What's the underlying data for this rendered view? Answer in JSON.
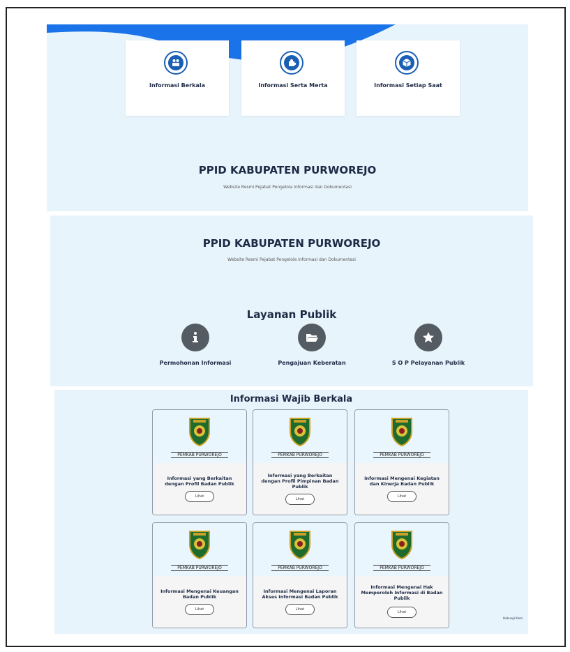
{
  "hero": {
    "categories": [
      {
        "label": "Informasi Berkala",
        "icon": "users-icon"
      },
      {
        "label": "Informasi Serta Merta",
        "icon": "puzzle-icon"
      },
      {
        "label": "Informasi Setiap Saat",
        "icon": "box-icon"
      }
    ],
    "title": "PPID KABUPATEN PURWOREJO",
    "subtitle": "Website Resmi Pejabat Pengelola Informasi dan Dokumentasi"
  },
  "layanan": {
    "header_title": "PPID KABUPATEN PURWOREJO",
    "header_subtitle": "Website Resmi Pejabat Pengelola Informasi dan Dokumentasi",
    "title": "Layanan Publik",
    "services": [
      {
        "label": "Permohonan Informasi",
        "icon": "info-icon"
      },
      {
        "label": "Pengajuan Keberatan",
        "icon": "folder-icon"
      },
      {
        "label": "S O P Pelayanan Publik",
        "icon": "star-icon"
      }
    ]
  },
  "wajib": {
    "title": "Informasi Wajib Berkala",
    "cards": [
      {
        "emblem_caption": "PEMKAB PURWOREJO",
        "text": "Informasi yang Berkaitan dengan Profil Badan Publik",
        "button": "Lihat"
      },
      {
        "emblem_caption": "PEMKAB PURWOREJO",
        "text": "Informasi yang Berkaitan dengan Profil Pimpinan Badan Publik",
        "button": "Lihat"
      },
      {
        "emblem_caption": "PEMKAB PURWOREJO",
        "text": "Informasi Mengenai Kegiatan dan Kinerja Badan Publik",
        "button": "Lihat"
      },
      {
        "emblem_caption": "PEMKAB PURWOREJO",
        "text": "Informasi Mengenai Keuangan Badan Publik",
        "button": "Lihat"
      },
      {
        "emblem_caption": "PEMKAB PURWOREJO",
        "text": "Informasi Mengenai Laporan Akses Informasi Badan Publik",
        "button": "Lihat"
      },
      {
        "emblem_caption": "PEMKAB PURWOREJO",
        "text": "Informasi Mengenai Hak Memperoleh Informasi di Badan Publik",
        "button": "Lihat"
      }
    ],
    "contact_link": "Hubungi Kami"
  },
  "colors": {
    "accent": "#1a5fb4",
    "panel": "#e8f4fc",
    "service_icon": "#545b63"
  }
}
